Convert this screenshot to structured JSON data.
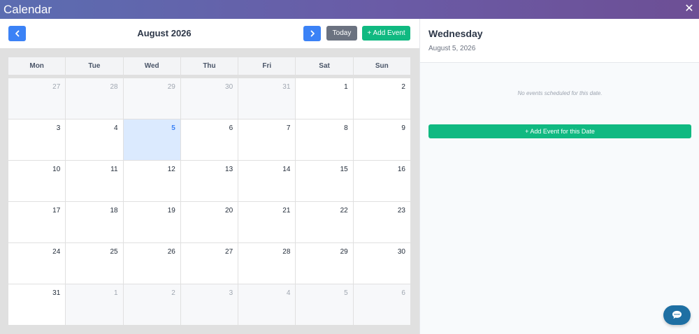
{
  "window": {
    "title": "Calendar",
    "close_icon": "close-icon"
  },
  "toolbar": {
    "prev_icon": "chevron-left-icon",
    "next_icon": "chevron-right-icon",
    "month_label": "August 2026",
    "today_label": "Today",
    "add_event_label": "+ Add Event"
  },
  "calendar": {
    "weekdays": [
      "Mon",
      "Tue",
      "Wed",
      "Thu",
      "Fri",
      "Sat",
      "Sun"
    ],
    "weeks": [
      [
        {
          "d": "27",
          "other": true
        },
        {
          "d": "28",
          "other": true
        },
        {
          "d": "29",
          "other": true
        },
        {
          "d": "30",
          "other": true
        },
        {
          "d": "31",
          "other": true
        },
        {
          "d": "1"
        },
        {
          "d": "2"
        }
      ],
      [
        {
          "d": "3"
        },
        {
          "d": "4"
        },
        {
          "d": "5",
          "selected": true
        },
        {
          "d": "6"
        },
        {
          "d": "7"
        },
        {
          "d": "8"
        },
        {
          "d": "9"
        }
      ],
      [
        {
          "d": "10"
        },
        {
          "d": "11"
        },
        {
          "d": "12"
        },
        {
          "d": "13"
        },
        {
          "d": "14"
        },
        {
          "d": "15"
        },
        {
          "d": "16"
        }
      ],
      [
        {
          "d": "17"
        },
        {
          "d": "18"
        },
        {
          "d": "19"
        },
        {
          "d": "20"
        },
        {
          "d": "21"
        },
        {
          "d": "22"
        },
        {
          "d": "23"
        }
      ],
      [
        {
          "d": "24"
        },
        {
          "d": "25"
        },
        {
          "d": "26"
        },
        {
          "d": "27"
        },
        {
          "d": "28"
        },
        {
          "d": "29"
        },
        {
          "d": "30"
        }
      ],
      [
        {
          "d": "31"
        },
        {
          "d": "1",
          "other": true
        },
        {
          "d": "2",
          "other": true
        },
        {
          "d": "3",
          "other": true
        },
        {
          "d": "4",
          "other": true
        },
        {
          "d": "5",
          "other": true
        },
        {
          "d": "6",
          "other": true
        }
      ]
    ]
  },
  "details": {
    "weekday": "Wednesday",
    "date": "August 5, 2026",
    "empty_message": "No events scheduled for this date.",
    "add_for_date_label": "+ Add Event for this Date"
  },
  "chat": {
    "icon": "chat-icon"
  },
  "colors": {
    "primary": "#3b82f6",
    "success": "#10b981",
    "neutral": "#6b7280",
    "selected_bg": "#dbeafe"
  }
}
